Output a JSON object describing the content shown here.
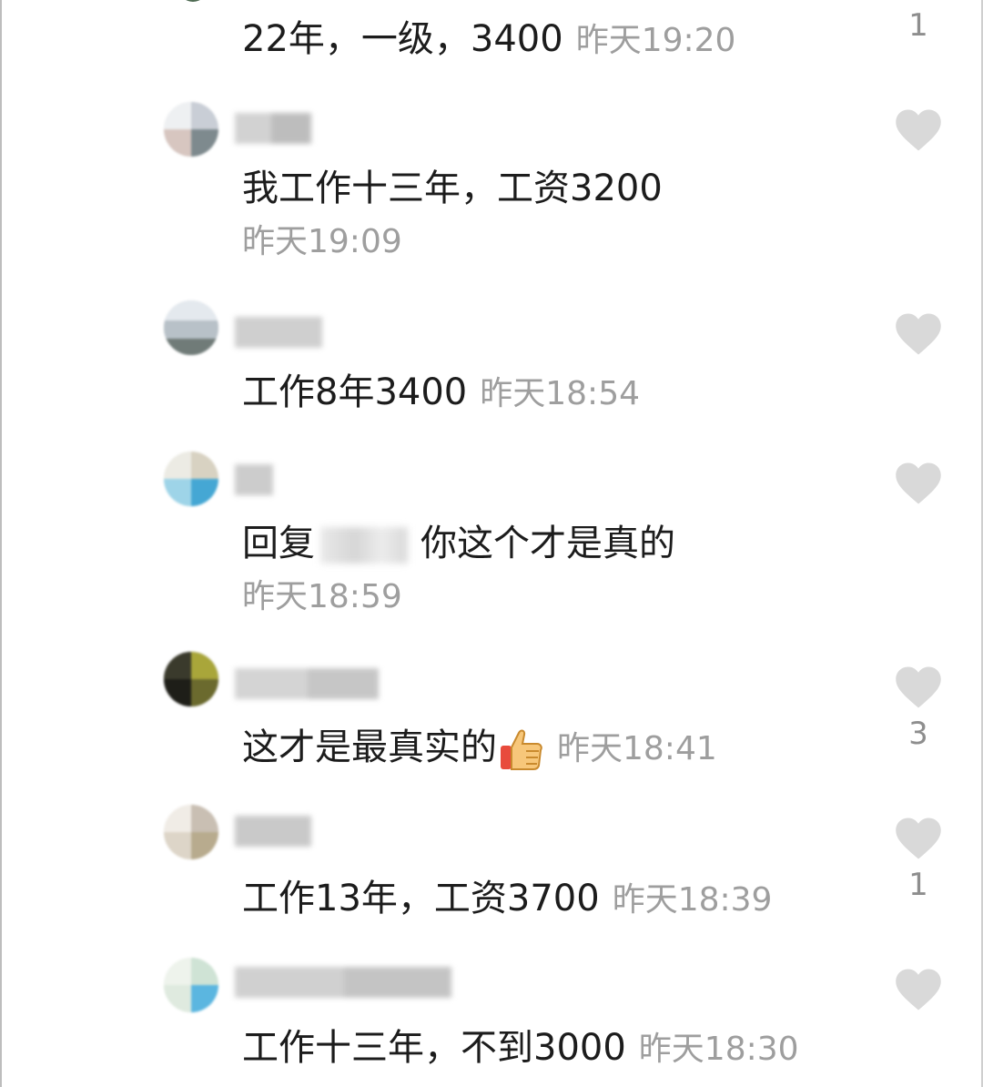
{
  "comments": [
    {
      "text": "22年，一级，3400",
      "time": "昨天19:20",
      "like_count": "1"
    },
    {
      "text": "我工作十三年，工资3200",
      "time": "昨天19:09",
      "like_count": ""
    },
    {
      "text": "工作8年3400",
      "time": "昨天18:54",
      "like_count": ""
    },
    {
      "reply_prefix": "回复",
      "text": "你这个才是真的",
      "time": "昨天18:59",
      "like_count": ""
    },
    {
      "text": "这才是最真实的",
      "emoji": "thumbs-up",
      "time": "昨天18:41",
      "like_count": "3"
    },
    {
      "text": "工作13年，工资3700",
      "time": "昨天18:39",
      "like_count": "1"
    },
    {
      "text": "工作十三年，不到3000",
      "time": "昨天18:30",
      "like_count": ""
    }
  ],
  "colors": {
    "text": "#1c1c1c",
    "time": "#9e9e9e",
    "like_icon": "#d9d9d9",
    "like_count": "#8e8e8e"
  }
}
